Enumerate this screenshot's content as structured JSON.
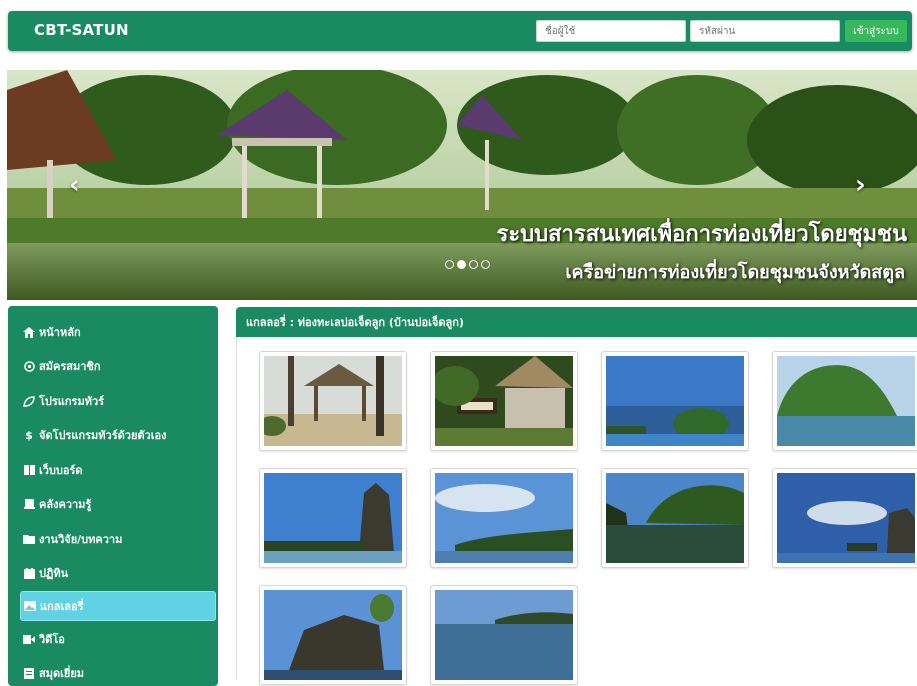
{
  "header": {
    "brand": "CBT-SATUN",
    "username_placeholder": "ชื่อผู้ใช้",
    "password_placeholder": "รหัสผ่าน",
    "login_label": "เข้าสู่ระบบ"
  },
  "carousel": {
    "caption_title": "ระบบสารสนเทศเพื่อการท่องเที่ยวโดยชุมชน",
    "caption_subtitle": "เครือข่ายการท่องเที่ยวโดยชุมชนจังหวัดสตูล",
    "prev_arrow": "‹",
    "next_arrow": "›",
    "slide_count": 4,
    "active_slide": 2
  },
  "sidebar": {
    "items": [
      {
        "label": "หน้าหลัก",
        "icon": "home-icon"
      },
      {
        "label": "สมัครสมาชิก",
        "icon": "register-icon"
      },
      {
        "label": "โปรแกรมทัวร์",
        "icon": "leaf-icon"
      },
      {
        "label": "จัดโปรแกรมทัวร์ด้วยตัวเอง",
        "icon": "dollar-icon"
      },
      {
        "label": "เว็บบอร์ด",
        "icon": "columns-icon"
      },
      {
        "label": "คลังความรู้",
        "icon": "book-icon"
      },
      {
        "label": "งานวิจัย/บทความ",
        "icon": "folder-icon"
      },
      {
        "label": "ปฏิทิน",
        "icon": "calendar-icon"
      },
      {
        "label": "แกลเลอรี่",
        "icon": "image-icon",
        "active": true
      },
      {
        "label": "วิดีโอ",
        "icon": "video-icon"
      },
      {
        "label": "สมุดเยี่ยม",
        "icon": "guestbook-icon"
      }
    ]
  },
  "gallery": {
    "heading": "แกลลอรี่ : ท่องทะเลบ่อเจ็ดลูก (บ้านบ่อเจ็ดลูก)",
    "photos": [
      {
        "name": "beach-hut-photo"
      },
      {
        "name": "homestay-sign-photo"
      },
      {
        "name": "small-island-photo"
      },
      {
        "name": "green-island-photo"
      },
      {
        "name": "rock-cliff-photo"
      },
      {
        "name": "coastline-photo"
      },
      {
        "name": "cliff-reflection-photo"
      },
      {
        "name": "distant-rocks-photo"
      },
      {
        "name": "limestone-rock-photo"
      },
      {
        "name": "calm-sea-photo"
      }
    ]
  }
}
